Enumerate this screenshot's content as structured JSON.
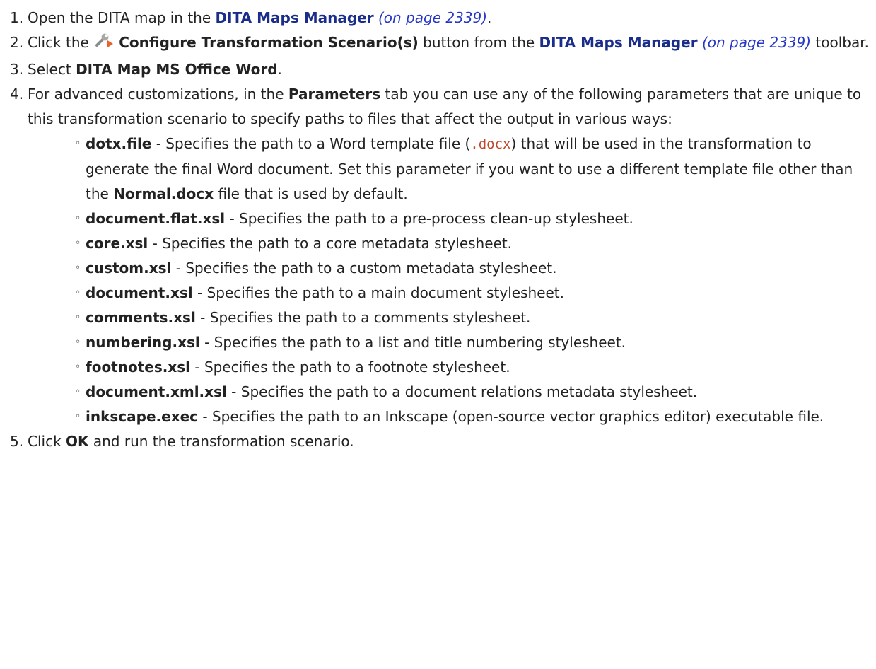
{
  "steps": [
    {
      "num": "1.",
      "prefix": "Open the DITA map in the ",
      "link": "DITA Maps Manager",
      "ref": "(on page 2339)",
      "suffix": "."
    },
    {
      "num": "2.",
      "prefix": "Click the ",
      "button": "Configure Transformation Scenario(s)",
      "middle": " button from the ",
      "link": "DITA Maps Manager",
      "ref": "(on page 2339)",
      "suffix": " toolbar."
    },
    {
      "num": "3.",
      "prefix": "Select ",
      "bold": "DITA Map MS Office Word",
      "suffix": "."
    },
    {
      "num": "4.",
      "prefix": "For advanced customizations, in the ",
      "bold": "Parameters",
      "suffix": " tab you can use any of the following parameters that are unique to this transformation scenario to specify paths to files that affect the output in various ways:"
    },
    {
      "num": "5.",
      "prefix": "Click ",
      "bold": "OK",
      "suffix": " and run the transformation scenario."
    }
  ],
  "params": [
    {
      "name": "dotx.file",
      "text_a": " - Specifies the path to a Word template file (",
      "code": ".docx",
      "text_b": ") that will be used in the transformation to generate the final Word document. Set this parameter if you want to use a different template file other than the ",
      "bold": "Normal.docx",
      "text_c": " file that is used by default."
    },
    {
      "name": "document.flat.xsl",
      "desc": " - Specifies the path to a pre-process clean-up stylesheet."
    },
    {
      "name": "core.xsl",
      "desc": " - Specifies the path to a core metadata stylesheet."
    },
    {
      "name": "custom.xsl",
      "desc": " - Specifies the path to a custom metadata stylesheet."
    },
    {
      "name": "document.xsl",
      "desc": " - Specifies the path to a main document stylesheet."
    },
    {
      "name": "comments.xsl",
      "desc": " - Specifies the path to a comments stylesheet."
    },
    {
      "name": "numbering.xsl",
      "desc": " - Specifies the path to a list and title numbering stylesheet."
    },
    {
      "name": "footnotes.xsl",
      "desc": " - Specifies the path to a footnote stylesheet."
    },
    {
      "name": "document.xml.xsl",
      "desc": " - Specifies the path to a document relations metadata stylesheet."
    },
    {
      "name": "inkscape.exec",
      "desc": " - Specifies the path to an Inkscape (open-source vector graphics editor) executable file."
    }
  ],
  "bullet": "◦",
  "icons": {
    "configure": "wrench-with-run-arrow-icon"
  },
  "colors": {
    "link": "#1a2d8a",
    "page_ref": "#2537c4",
    "code": "#c0492c",
    "text": "#222222"
  }
}
